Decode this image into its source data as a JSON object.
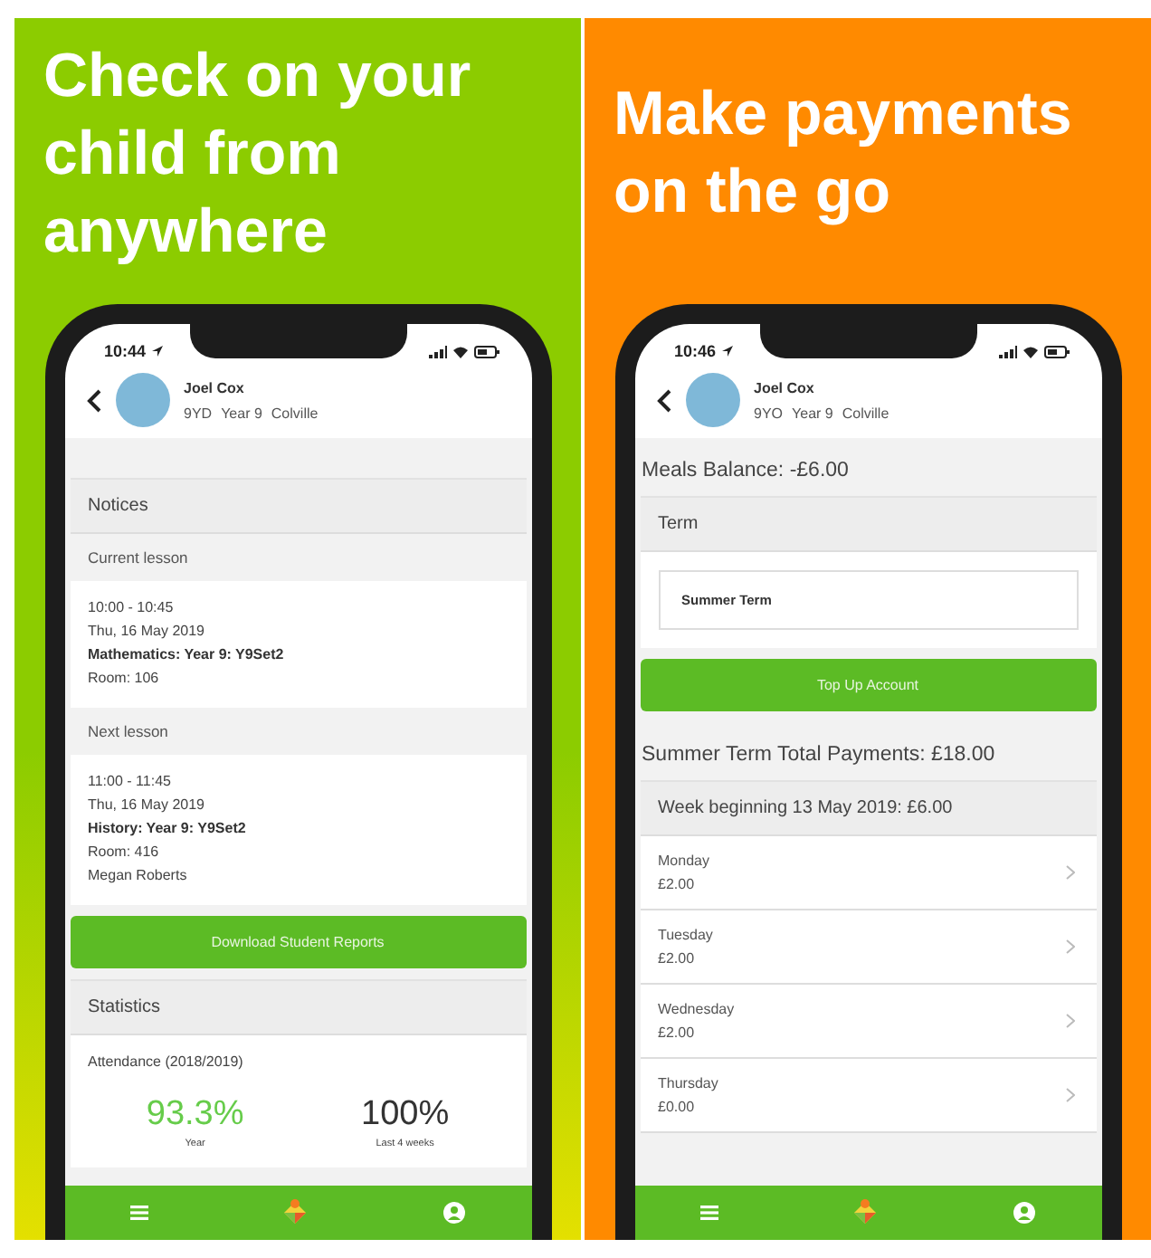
{
  "panels": [
    {
      "color": "#8ccc00",
      "headline": [
        "Check on your",
        "child from",
        "anywhere"
      ],
      "screen": {
        "time": "10:44",
        "student": {
          "name": "Joel Cox",
          "details": [
            "9YD",
            "Year 9",
            "Colville"
          ]
        },
        "blocks": [
          {
            "kind": "section",
            "text": "Notices"
          },
          {
            "kind": "subheader",
            "text": "Current lesson"
          },
          {
            "kind": "lines",
            "lines": [
              {
                "text": "10:00 - 10:45",
                "bold": false
              },
              {
                "text": "Thu, 16 May 2019",
                "bold": false
              },
              {
                "text": "Mathematics: Year 9: Y9Set2",
                "bold": true
              },
              {
                "text": "Room: 106",
                "bold": false
              }
            ]
          },
          {
            "kind": "subheader",
            "text": "Next lesson"
          },
          {
            "kind": "lines",
            "lines": [
              {
                "text": "11:00 - 11:45",
                "bold": false
              },
              {
                "text": "Thu, 16 May 2019",
                "bold": false
              },
              {
                "text": "History: Year 9: Y9Set2",
                "bold": true
              },
              {
                "text": "Room: 416",
                "bold": false
              },
              {
                "text": "Megan Roberts",
                "bold": false
              }
            ]
          },
          {
            "kind": "button",
            "label": "Download Student Reports"
          },
          {
            "kind": "section",
            "text": "Statistics"
          },
          {
            "kind": "stats",
            "title": "Attendance (2018/2019)",
            "items": [
              {
                "value": "93.3%",
                "label": "Year",
                "color": "#66cc4a"
              },
              {
                "value": "100%",
                "label": "Last 4 weeks",
                "color": "#333333"
              }
            ]
          }
        ]
      }
    },
    {
      "color": "#ff8a00",
      "headline": [
        "Make payments",
        "on the go"
      ],
      "screen": {
        "time": "10:46",
        "student": {
          "name": "Joel Cox",
          "details": [
            "9YO",
            "Year 9",
            "Colville"
          ]
        },
        "blocks": [
          {
            "kind": "heading",
            "text": "Meals Balance: -£6.00"
          },
          {
            "kind": "section",
            "text": "Term"
          },
          {
            "kind": "field",
            "value": "Summer Term"
          },
          {
            "kind": "button",
            "label": "Top Up Account"
          },
          {
            "kind": "heading",
            "text": "Summer Term Total Payments: £18.00"
          },
          {
            "kind": "section",
            "text": "Week beginning 13 May 2019: £6.00"
          },
          {
            "kind": "row",
            "title": "Monday",
            "amount": "£2.00"
          },
          {
            "kind": "row",
            "title": "Tuesday",
            "amount": "£2.00"
          },
          {
            "kind": "row",
            "title": "Wednesday",
            "amount": "£2.00"
          },
          {
            "kind": "row",
            "title": "Thursday",
            "amount": "£0.00"
          }
        ]
      }
    }
  ]
}
